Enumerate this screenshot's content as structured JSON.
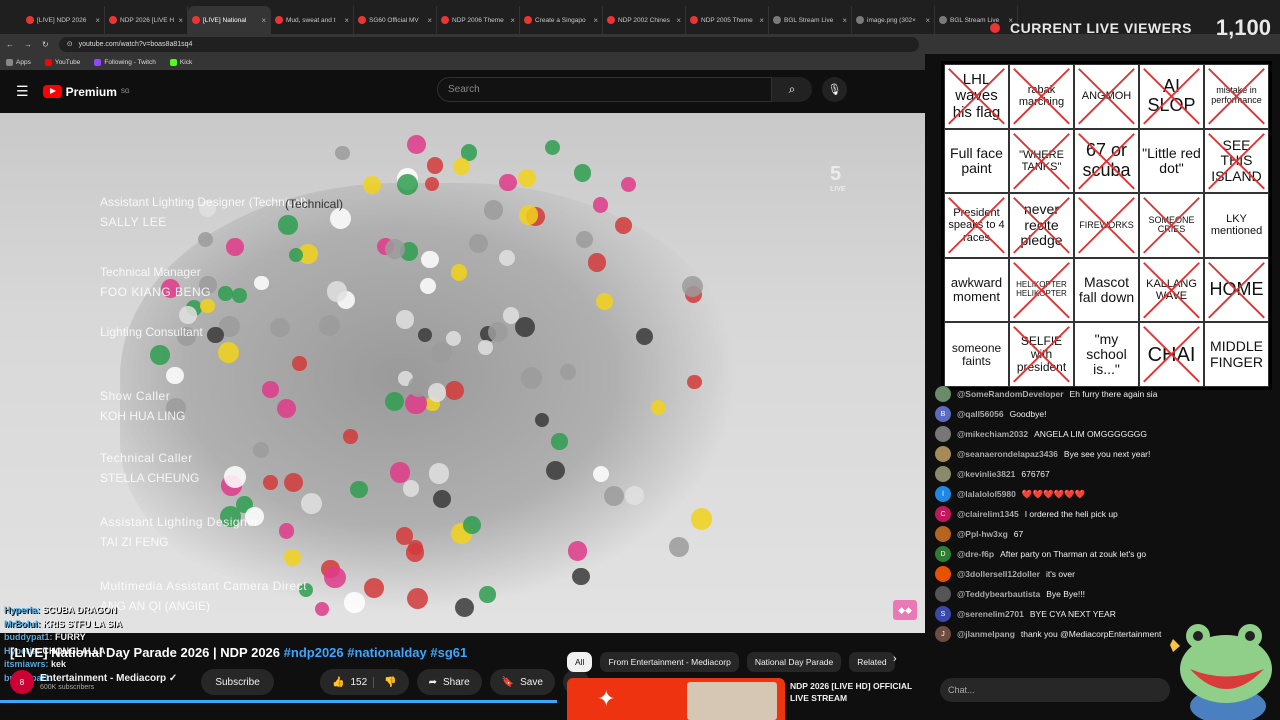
{
  "browser": {
    "tabs": [
      {
        "title": "[LIVE] NDP 2026",
        "active": false
      },
      {
        "title": "NDP 2026 [LIVE H",
        "active": false
      },
      {
        "title": "[LIVE] National",
        "active": true
      },
      {
        "title": "Mud, sweat and t",
        "active": false
      },
      {
        "title": "SG60 Official MV",
        "active": false
      },
      {
        "title": "NDP 2006 Theme",
        "active": false
      },
      {
        "title": "Create a Singapo",
        "active": false
      },
      {
        "title": "NDP 2002 Chines",
        "active": false
      },
      {
        "title": "NDP 2005 Theme",
        "active": false
      },
      {
        "title": "BGL Stream Live",
        "active": false
      },
      {
        "title": "image.png (302×",
        "active": false
      },
      {
        "title": "BGL Stream Live",
        "active": false
      }
    ],
    "url": "youtube.com/watch?v=boas8a81sq4",
    "bookmarks": [
      {
        "label": "Apps",
        "color": "#888888"
      },
      {
        "label": "YouTube",
        "color": "#ff0000"
      },
      {
        "label": "Following - Twitch",
        "color": "#9146ff"
      },
      {
        "label": "Kick",
        "color": "#53fc18"
      }
    ]
  },
  "youtube": {
    "logo_text": "Premium",
    "logo_region": "SG",
    "search_placeholder": "Search"
  },
  "video": {
    "credits": [
      {
        "text": "Assistant Lighting Designer (Technical)"
      },
      {
        "text": "SALLY LEE"
      },
      {
        "text": "Technical Manager"
      },
      {
        "text": "FOO KIANG BENG"
      },
      {
        "text": "Lighting Consultant"
      },
      {
        "text": "Show Caller"
      },
      {
        "text": "KOH HUA LING"
      },
      {
        "text": "Technical Caller"
      },
      {
        "text": "STELLA CHEUNG"
      },
      {
        "text": "Assistant Lighting Designer"
      },
      {
        "text": "TAI ZI FENG"
      },
      {
        "text": "Multimedia Assistant Camera Direct"
      },
      {
        "text": "ANG AN QI (ANGIE)"
      }
    ],
    "channel_bug": "5",
    "channel_bug_sub": "LIVE",
    "tech_label": "(Technical)"
  },
  "overlay_chat": [
    {
      "user": "Hyperia:",
      "text": "SCUBA DRAGON"
    },
    {
      "user": "MrBolui:",
      "text": "KRIS STFU LA SIA"
    },
    {
      "user": "buddypat1:",
      "text": "FURRY"
    },
    {
      "user": "Hyperia:",
      "text": "CHONGLALLA"
    },
    {
      "user": "itsmiawrs:",
      "text": "kek"
    },
    {
      "user": "buddypat1:",
      "text": ""
    }
  ],
  "meta": {
    "title_text": "[LIVE] National Day Parade 2026 | NDP 2026",
    "hashtags": [
      "#ndp2026",
      "#nationalday",
      "#sg61"
    ],
    "channel": "Entertainment - Mediacorp",
    "subscribers": "600K subscribers",
    "avatar_text": "8",
    "subscribe_label": "Subscribe",
    "likes": "152",
    "share_label": "Share",
    "save_label": "Save"
  },
  "chips": [
    {
      "label": "All",
      "active": true
    },
    {
      "label": "From Entertainment - Mediacorp",
      "active": false
    },
    {
      "label": "National Day Parade",
      "active": false
    },
    {
      "label": "Related",
      "active": false
    }
  ],
  "recommended": {
    "title": "NDP 2026 [LIVE HD] OFFICIAL LIVE STREAM"
  },
  "viewers": {
    "label": "CURRENT LIVE VIEWERS",
    "count": "1,100"
  },
  "bingo": [
    {
      "text": "LHL waves his flag",
      "crossed": true,
      "size": 15
    },
    {
      "text": "rabak marching",
      "crossed": true,
      "size": 11
    },
    {
      "text": "ANGMOH",
      "crossed": true,
      "size": 11
    },
    {
      "text": "AI SLOP",
      "crossed": true,
      "size": 18
    },
    {
      "text": "mistake in performance",
      "crossed": true,
      "size": 9
    },
    {
      "text": "Full face paint",
      "crossed": false,
      "size": 14
    },
    {
      "text": "\"WHERE TANKS\"",
      "crossed": true,
      "size": 11
    },
    {
      "text": "67 or scuba",
      "crossed": true,
      "size": 18
    },
    {
      "text": "\"Little red dot\"",
      "crossed": false,
      "size": 14
    },
    {
      "text": "SEE THIS ISLAND",
      "crossed": true,
      "size": 14
    },
    {
      "text": "President speaks to 4 races",
      "crossed": true,
      "size": 11
    },
    {
      "text": "never recite pledge",
      "crossed": true,
      "size": 14
    },
    {
      "text": "FIREWORKS",
      "crossed": true,
      "size": 9
    },
    {
      "text": "SOMEONE CRIES",
      "crossed": true,
      "size": 9
    },
    {
      "text": "LKY mentioned",
      "crossed": false,
      "size": 11
    },
    {
      "text": "awkward moment",
      "crossed": false,
      "size": 13
    },
    {
      "text": "HELIKOPTER HELIKOPTER",
      "crossed": true,
      "size": 8
    },
    {
      "text": "Mascot fall down",
      "crossed": false,
      "size": 14
    },
    {
      "text": "KALLANG WAVE",
      "crossed": true,
      "size": 11
    },
    {
      "text": "HOME",
      "crossed": true,
      "size": 18
    },
    {
      "text": "someone faints",
      "crossed": false,
      "size": 12
    },
    {
      "text": "SELFIE with president",
      "crossed": true,
      "size": 12
    },
    {
      "text": "\"my school is...\"",
      "crossed": false,
      "size": 14
    },
    {
      "text": "CHAI",
      "crossed": true,
      "size": 20
    },
    {
      "text": "MIDDLE FINGER",
      "crossed": false,
      "size": 14
    }
  ],
  "chat": [
    {
      "user": "@SomeRandomDeveloper",
      "text": "Eh furry there again sia",
      "color": "#6a8a6a",
      "initial": ""
    },
    {
      "user": "@qall56056",
      "text": "Goodbye!",
      "color": "#5c6bc0",
      "initial": "B"
    },
    {
      "user": "@mikechiam2032",
      "text": "ANGELA LIM OMGGGGGGG",
      "color": "#777777",
      "initial": ""
    },
    {
      "user": "@seanaerondelapaz3436",
      "text": "Bye see you next year!",
      "color": "#a58b5a",
      "initial": ""
    },
    {
      "user": "@kevinlie3821",
      "text": "676767",
      "color": "#8a8a6a",
      "initial": ""
    },
    {
      "user": "@lalalolol5980",
      "text": "❤️❤️❤️❤️❤️❤️",
      "color": "#1e88e5",
      "initial": "l"
    },
    {
      "user": "@clairelim1345",
      "text": "I ordered the heli pick up",
      "color": "#c2185b",
      "initial": "C"
    },
    {
      "user": "@Ppl-hw3xg",
      "text": "67",
      "color": "#b5651d",
      "initial": ""
    },
    {
      "user": "@dre-f6p",
      "text": "After party on Tharman at zouk let's go",
      "color": "#2e7d32",
      "initial": "D"
    },
    {
      "user": "@3dollersell12doller",
      "text": "it's over",
      "color": "#e65100",
      "initial": ""
    },
    {
      "user": "@Teddybearbautista",
      "text": "Bye Bye!!!",
      "color": "#555555",
      "initial": ""
    },
    {
      "user": "@serenelim2701",
      "text": "BYE CYA NEXT YEAR",
      "color": "#3949ab",
      "initial": "S"
    },
    {
      "user": "@jlanmelpang",
      "text": "thank you @MediacorpEntertainment",
      "color": "#6d4c41",
      "initial": "J"
    }
  ],
  "chat_placeholder": "Chat..."
}
